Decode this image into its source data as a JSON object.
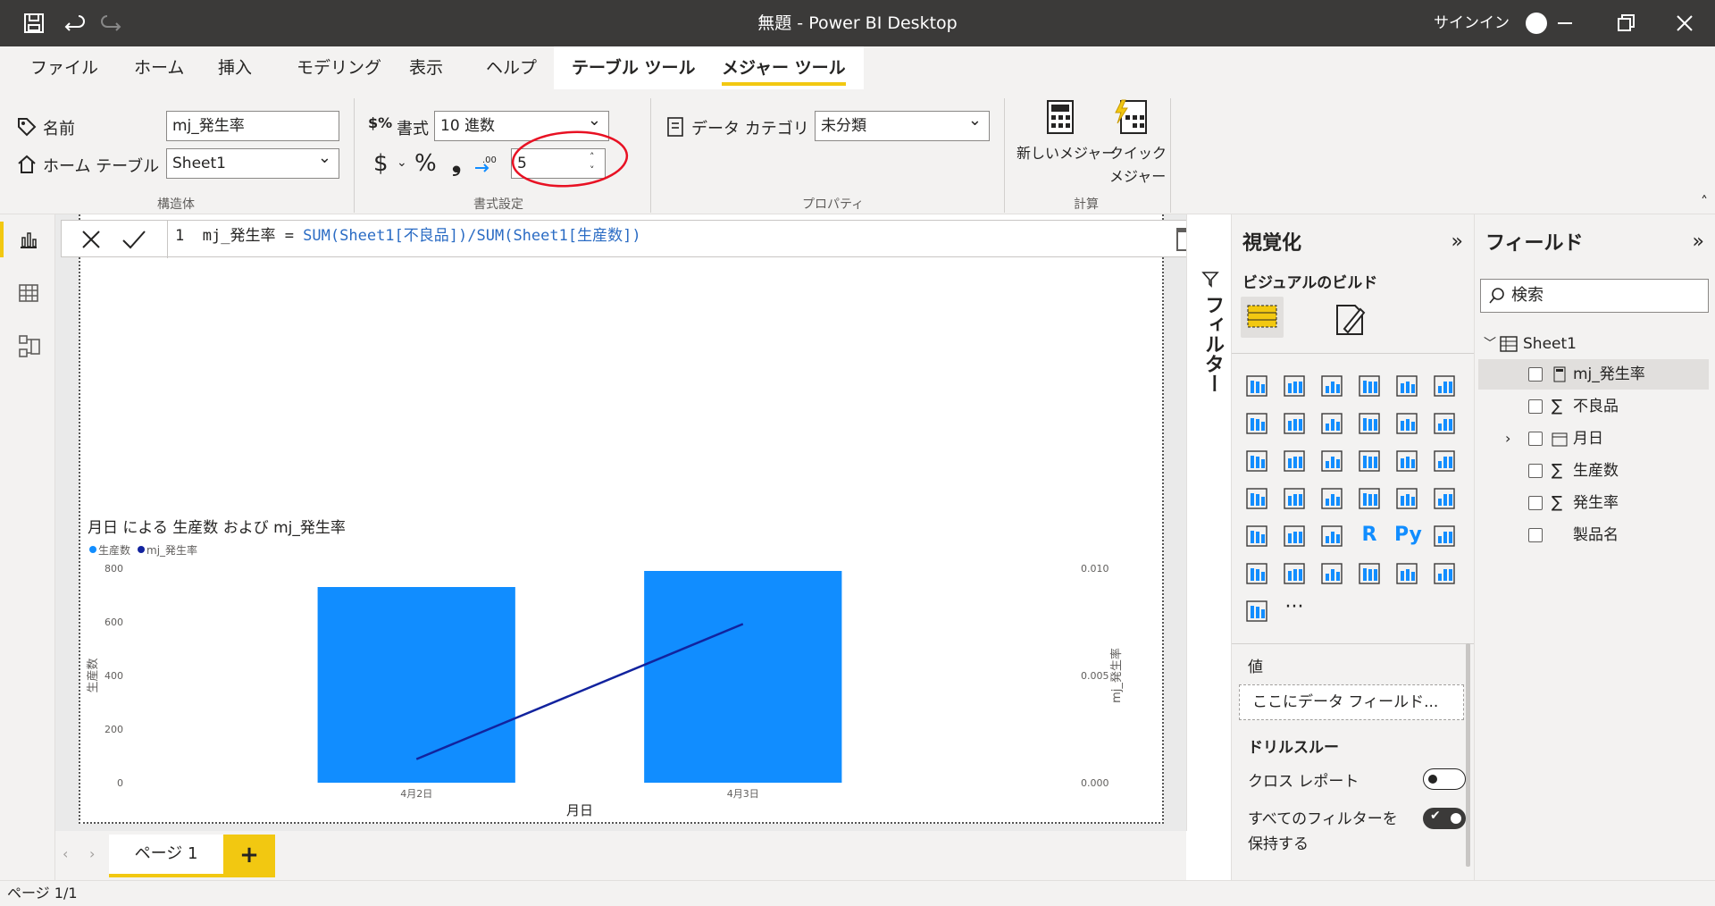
{
  "titlebar": {
    "title": "無題 - Power BI Desktop",
    "signin": "サインイン"
  },
  "menu": {
    "tabs": [
      "ファイル",
      "ホーム",
      "挿入",
      "モデリング",
      "表示",
      "ヘルプ",
      "テーブル ツール",
      "メジャー ツール"
    ],
    "active": "メジャー ツール"
  },
  "ribbon": {
    "name_label": "名前",
    "name_value": "mj_発生率",
    "home_table_label": "ホーム テーブル",
    "home_table_value": "Sheet1",
    "structure_group": "構造体",
    "format_label": "書式",
    "format_value": "10 進数",
    "currency_symbol": "$",
    "percent_symbol": "%",
    "comma_symbol": "❟",
    "decimals_value": "5",
    "format_group": "書式設定",
    "data_category_label": "データ カテゴリ",
    "data_category_value": "未分類",
    "properties_group": "プロパティ",
    "new_measure": "新しいメジャー",
    "quick_measure_1": "クイック",
    "quick_measure_2": "メジャー",
    "calc_group": "計算"
  },
  "formula": {
    "line": "1",
    "name": "mj_発生率",
    "eq": " = ",
    "f1": "SUM",
    "a1": "(Sheet1[不良品])/",
    "f2": "SUM",
    "a2": "(Sheet1[生産数])"
  },
  "filters": {
    "label": "フィルター"
  },
  "viz": {
    "title": "視覚化",
    "build": "ビジュアルのビルド",
    "values_label": "値",
    "drop_placeholder": "ここにデータ フィールド...",
    "drillthrough": "ドリルスルー",
    "cross_report": "クロス レポート",
    "keep_filters_1": "すべてのフィルターを",
    "keep_filters_2": "保持する",
    "more": "···",
    "r_icon": "R",
    "py_icon": "Py"
  },
  "fields": {
    "title": "フィールド",
    "search_placeholder": "検索",
    "table": "Sheet1",
    "items": [
      "mj_発生率",
      "不良品",
      "月日",
      "生産数",
      "発生率",
      "製品名"
    ]
  },
  "page": {
    "tab": "ページ 1",
    "add": "+",
    "status": "ページ 1/1"
  },
  "colors": {
    "accent": "#f2c811",
    "bar": "#118dff",
    "line": "#12239e",
    "annotation": "#e81123"
  },
  "chart_data": {
    "type": "bar",
    "title": "月日 による 生産数 および mj_発生率",
    "categories": [
      "4月2日",
      "4月3日"
    ],
    "series": [
      {
        "name": "生産数",
        "type": "bar",
        "axis": "left",
        "values": [
          730,
          790
        ]
      },
      {
        "name": "mj_発生率",
        "type": "line",
        "axis": "right",
        "values": [
          0.0011,
          0.0074
        ]
      }
    ],
    "xlabel": "月日",
    "ylabel": "生産数",
    "y2label": "mj_発生率",
    "ylim": [
      0,
      800
    ],
    "y2lim": [
      0,
      0.01
    ],
    "yticks": [
      "0",
      "200",
      "400",
      "600",
      "800"
    ],
    "y2ticks": [
      "0.000",
      "0.005",
      "0.010"
    ],
    "legend": "top-left",
    "grid": false
  }
}
